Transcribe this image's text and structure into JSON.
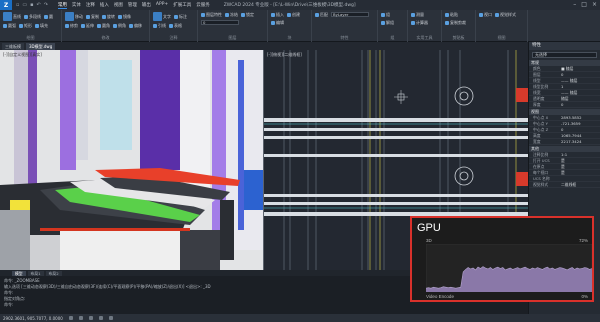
{
  "window": {
    "title": "ZWCAD 2024 专业版 - [E:\\L-Win\\Drive\\三维板模\\3D模型.dwg]",
    "tabs": [
      "常用",
      "实体",
      "注释",
      "插入",
      "视图",
      "管理",
      "输出",
      "APP+",
      "扩展工具",
      "云服务"
    ],
    "active_tab": "常用"
  },
  "ribbon": {
    "groups": [
      {
        "name": "绘图",
        "buttons": [
          "直线",
          "多段线",
          "圆",
          "圆弧",
          "矩形",
          "填充"
        ]
      },
      {
        "name": "修改",
        "buttons": [
          "移动",
          "复制",
          "旋转",
          "镜像",
          "修剪",
          "延伸",
          "圆角",
          "倒角",
          "偏移"
        ]
      },
      {
        "name": "注释",
        "buttons": [
          "文字",
          "标注",
          "引线",
          "表格"
        ]
      },
      {
        "name": "图层",
        "buttons": [
          "图层特性",
          "冻结",
          "锁定"
        ],
        "combo": "0"
      },
      {
        "name": "块",
        "buttons": [
          "插入",
          "创建",
          "编辑"
        ]
      },
      {
        "name": "特性",
        "buttons": [
          "匹配"
        ],
        "combo": "ByLayer"
      },
      {
        "name": "组",
        "buttons": [
          "组",
          "解组"
        ]
      },
      {
        "name": "实用工具",
        "buttons": [
          "测量",
          "计算器"
        ]
      },
      {
        "name": "剪贴板",
        "buttons": [
          "粘贴",
          "复制剪裁"
        ]
      },
      {
        "name": "视图",
        "buttons": [
          "视口",
          "视觉样式"
        ]
      }
    ]
  },
  "doc_tabs": [
    "三维板模",
    "3D模型.dwg"
  ],
  "active_doc_tab": "3D模型.dwg",
  "viewport_labels": {
    "left": "[-][自定义视图][真实]",
    "right": "[-][俯视][二维线框]"
  },
  "layout_tabs": [
    "模型",
    "布局1",
    "布局2"
  ],
  "active_layout_tab": "模型",
  "properties": {
    "title": "特性",
    "selection": "无选择",
    "sections": [
      {
        "name": "常规",
        "rows": [
          [
            "颜色",
            "■ 随层"
          ],
          [
            "图层",
            "0"
          ],
          [
            "线型",
            "—— 随层"
          ],
          [
            "线型比例",
            "1"
          ],
          [
            "线宽",
            "—— 随层"
          ],
          [
            "透明度",
            "随层"
          ],
          [
            "厚度",
            "0"
          ]
        ]
      },
      {
        "name": "视图",
        "rows": [
          [
            "中心点 X",
            "2893.5852"
          ],
          [
            "中心点 Y",
            "-721.3659"
          ],
          [
            "中心点 Z",
            "0"
          ],
          [
            "高度",
            "1065.7944"
          ],
          [
            "宽度",
            "2217.3424"
          ]
        ]
      },
      {
        "name": "其他",
        "rows": [
          [
            "注释比例",
            "1:1"
          ],
          [
            "打开 UCS",
            "是"
          ],
          [
            "在原点",
            "是"
          ],
          [
            "每个视口",
            "是"
          ],
          [
            "UCS 名称",
            ""
          ],
          [
            "视觉样式",
            "二维线框"
          ]
        ]
      }
    ]
  },
  "command": {
    "lines": [
      "命令:  _ZOOMBASE",
      "输入选项 [三维动态观察(3D)/三维自由动态观察(3F)/连续(C)/平面观察(P)/平移(PA)/缩放(Z)/退出(X)] <退出>:  _3D",
      "命令:",
      "指定对角点:",
      "命令:"
    ]
  },
  "status": {
    "coords": "2902.3601, 905.7077, 0.0000"
  },
  "gpu_overlay": {
    "title": "GPU",
    "engine_top": "3D",
    "engine_bottom": "Video Encode",
    "top_value": "72%",
    "bottom_value": "0%",
    "usage": [
      8,
      9,
      8,
      10,
      9,
      8,
      9,
      11,
      10,
      9,
      10,
      9,
      8,
      9,
      10,
      42,
      47,
      51,
      48,
      50,
      46,
      52,
      49,
      53,
      50,
      48,
      51,
      47,
      50,
      52,
      49,
      51,
      46,
      48,
      50,
      47,
      49,
      51,
      48,
      50,
      52,
      49,
      47,
      50,
      48,
      51,
      49,
      47,
      50,
      52,
      48,
      50,
      47,
      49,
      51,
      50,
      48,
      46,
      49,
      51,
      47,
      50,
      48,
      49,
      51,
      50,
      47,
      49
    ],
    "colors": {
      "border": "#d9312b",
      "fill": "#8a78a8",
      "line": "#b6a6d0"
    }
  }
}
